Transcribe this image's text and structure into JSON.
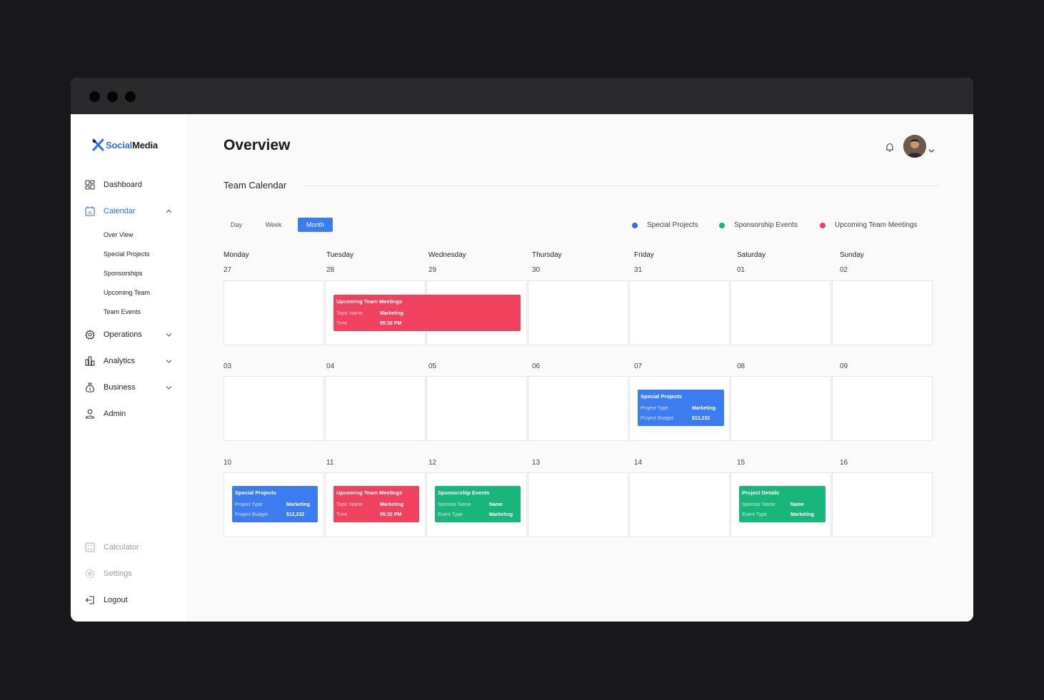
{
  "brand": {
    "part1": "Social",
    "part2": "Media"
  },
  "sidebar": {
    "nav": [
      {
        "label": "Dashboard",
        "icon": "dashboard-icon"
      },
      {
        "label": "Calendar",
        "icon": "calendar-icon",
        "icon_text": "31",
        "active": true
      },
      {
        "label": "Operations",
        "icon": "gear-icon"
      },
      {
        "label": "Analytics",
        "icon": "analytics-icon"
      },
      {
        "label": "Business",
        "icon": "money-bag-icon"
      },
      {
        "label": "Admin",
        "icon": "user-icon"
      }
    ],
    "calendar_sub": [
      "Over View",
      "Special Projects",
      "Sponsorships",
      "Upcoming Team",
      "Team Events"
    ],
    "bottom": [
      {
        "label": "Calculator",
        "icon": "calculator-icon"
      },
      {
        "label": "Settings",
        "icon": "settings-icon"
      },
      {
        "label": "Logout",
        "icon": "logout-icon"
      }
    ]
  },
  "header": {
    "title": "Overview",
    "section": "Team Calendar"
  },
  "view_toggle": {
    "day": "Day",
    "week": "Week",
    "month": "Month",
    "selected": "Month"
  },
  "legend": [
    {
      "label": "Special Projects",
      "color": "#2f6fe4"
    },
    {
      "label": "Sponsorship Events",
      "color": "#18b67a"
    },
    {
      "label": "Upcoming Team Meetings",
      "color": "#f0415e"
    }
  ],
  "calendar": {
    "day_names": [
      "Monday",
      "Tuesday",
      "Wednesday",
      "Thursday",
      "Friday",
      "Saturday",
      "Sunday"
    ],
    "weeks": [
      [
        "27",
        "28",
        "29",
        "30",
        "31",
        "01",
        "02"
      ],
      [
        "03",
        "04",
        "05",
        "06",
        "07",
        "08",
        "09"
      ],
      [
        "10",
        "11",
        "12",
        "13",
        "14",
        "15",
        "16"
      ]
    ],
    "events": [
      {
        "title": "Upcoming Team Meetings",
        "rows": [
          [
            "Topic Name",
            "Marketing"
          ],
          [
            "Time",
            "05:32 PM"
          ]
        ],
        "color": "red"
      },
      {
        "title": "Special Projects",
        "rows": [
          [
            "Project Type",
            "Marketing"
          ],
          [
            "Project Budget",
            "$12,232"
          ]
        ],
        "color": "blue"
      },
      {
        "title": "Special Projects",
        "rows": [
          [
            "Project Type",
            "Marketing"
          ],
          [
            "Project Budget",
            "$12,232"
          ]
        ],
        "color": "blue"
      },
      {
        "title": "Upcoming Team Meetings",
        "rows": [
          [
            "Topic Name",
            "Marketing"
          ],
          [
            "Time",
            "05:32 PM"
          ]
        ],
        "color": "red"
      },
      {
        "title": "Sponsorship Events",
        "rows": [
          [
            "Sponsor Name",
            "Name"
          ],
          [
            "Event Type",
            "Marketing"
          ]
        ],
        "color": "green"
      },
      {
        "title": "Project Details",
        "rows": [
          [
            "Sponsor Name",
            "Name"
          ],
          [
            "Event Type",
            "Marketing"
          ]
        ],
        "color": "green"
      }
    ]
  }
}
